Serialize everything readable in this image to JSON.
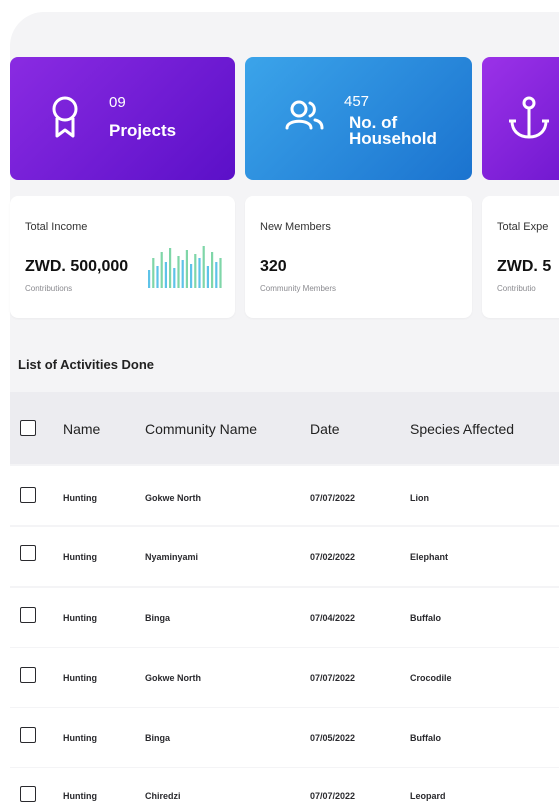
{
  "cards": {
    "projects": {
      "count": "09",
      "label": "Projects"
    },
    "household": {
      "count": "457",
      "label_line1": "No. of",
      "label_line2": "Household"
    }
  },
  "stats": {
    "income": {
      "title": "Total Income",
      "value": "ZWD. 500,000",
      "sub": "Contributions"
    },
    "members": {
      "title": "New Members",
      "value": "320",
      "sub": "Community Members"
    },
    "expenses": {
      "title": "Total Expe",
      "value": "ZWD. 5",
      "sub": "Contributio"
    }
  },
  "sparkline": {
    "colors": [
      "#5ec3e8",
      "#7fd6a8"
    ]
  },
  "table": {
    "title": "List of Activities Done",
    "columns": [
      "Name",
      "Community Name",
      "Date",
      "Species Affected"
    ],
    "rows": [
      {
        "name": "Hunting",
        "community": "Gokwe North",
        "date": "07/07/2022",
        "species": "Lion"
      },
      {
        "name": "Hunting",
        "community": "Nyaminyami",
        "date": "07/02/2022",
        "species": "Elephant"
      },
      {
        "name": "Hunting",
        "community": "Binga",
        "date": "07/04/2022",
        "species": "Buffalo"
      },
      {
        "name": "Hunting",
        "community": "Gokwe North",
        "date": "07/07/2022",
        "species": "Crocodile"
      },
      {
        "name": "Hunting",
        "community": "Binga",
        "date": "07/05/2022",
        "species": "Buffalo"
      },
      {
        "name": "Hunting",
        "community": "Chiredzi",
        "date": "07/07/2022",
        "species": "Leopard"
      }
    ]
  }
}
